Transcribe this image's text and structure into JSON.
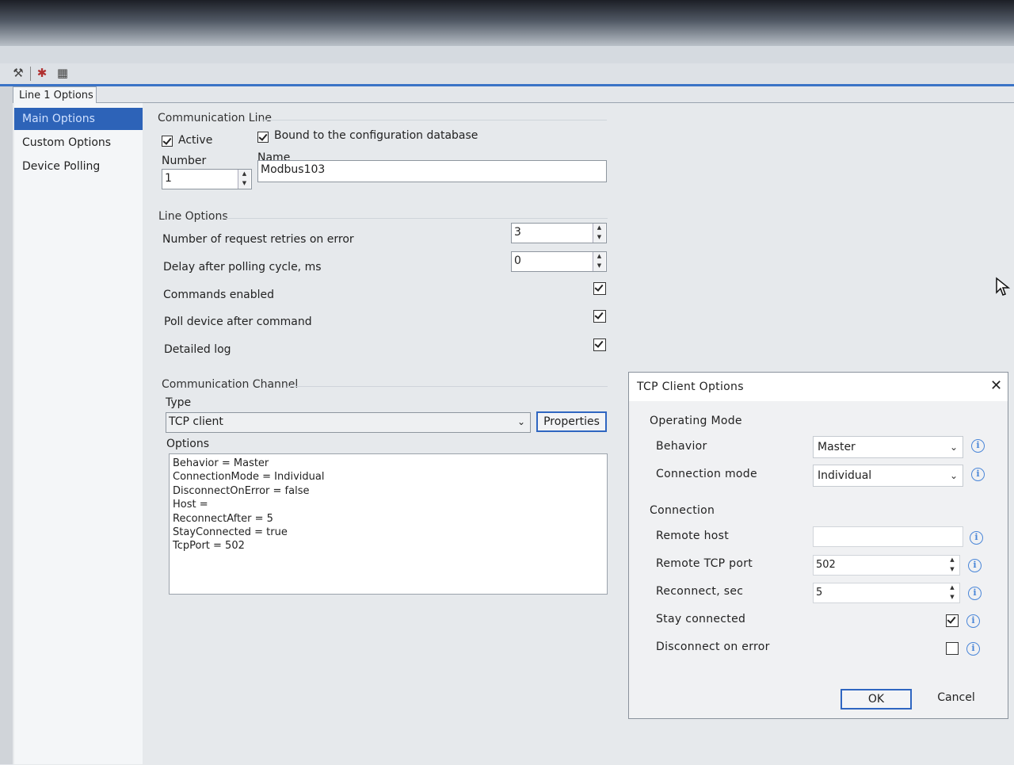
{
  "tab": {
    "label": "Line 1 Options"
  },
  "sidebar": {
    "items": [
      {
        "label": "Main Options"
      },
      {
        "label": "Custom Options"
      },
      {
        "label": "Device Polling"
      }
    ]
  },
  "communication_line": {
    "title": "Communication Line",
    "active_label": "Active",
    "active_checked": true,
    "bound_label": "Bound to the configuration database",
    "bound_checked": true,
    "number_label": "Number",
    "number_value": "1",
    "name_label": "Name",
    "name_value": "Modbus103"
  },
  "line_options": {
    "title": "Line Options",
    "retries_label": "Number of request retries on error",
    "retries_value": "3",
    "delay_label": "Delay after polling cycle, ms",
    "delay_value": "0",
    "commands_label": "Commands enabled",
    "poll_label": "Poll device after command",
    "log_label": "Detailed log"
  },
  "channel": {
    "title": "Communication Channel",
    "type_label": "Type",
    "type_value": "TCP client",
    "properties_label": "Properties",
    "options_label": "Options",
    "options_lines": [
      "Behavior = Master",
      "ConnectionMode = Individual",
      "DisconnectOnError = false",
      "Host =",
      "ReconnectAfter = 5",
      "StayConnected = true",
      "TcpPort = 502"
    ]
  },
  "dialog": {
    "title": "TCP Client Options",
    "close_symbol": "✕",
    "operating_mode_title": "Operating Mode",
    "behavior_label": "Behavior",
    "behavior_value": "Master",
    "connection_mode_label": "Connection mode",
    "connection_mode_value": "Individual",
    "connection_title": "Connection",
    "remote_host_label": "Remote host",
    "remote_host_value": "",
    "remote_port_label": "Remote TCP port",
    "remote_port_value": "502",
    "reconnect_label": "Reconnect, sec",
    "reconnect_value": "5",
    "stay_label": "Stay connected",
    "stay_checked": true,
    "disconnect_label": "Disconnect on error",
    "disconnect_checked": false,
    "ok_label": "OK",
    "cancel_label": "Cancel"
  },
  "icons": {
    "toolbar": [
      "wrench-icon",
      "tools-icon",
      "grid-icon"
    ],
    "info": "info-icon",
    "dropdown": "chevron-down-icon"
  },
  "colors": {
    "accent": "#2d63b8",
    "info": "#4a86d8"
  }
}
